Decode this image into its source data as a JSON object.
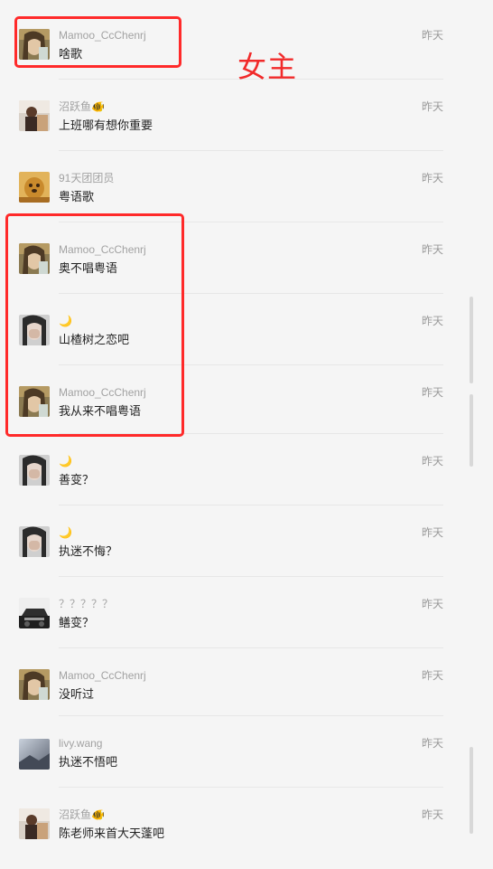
{
  "annotation": {
    "label": "女主",
    "color": "#f12a2a"
  },
  "messages": [
    {
      "name": "Mamoo_CcChenrj",
      "text": "啥歌",
      "time": "昨天",
      "avatar": "girl-avatar-icon"
    },
    {
      "name": "沼跃鱼🐠",
      "text": "上班哪有想你重要",
      "time": "昨天",
      "avatar": "man-avatar-icon"
    },
    {
      "name": "91天团团员",
      "text": "粤语歌",
      "time": "昨天",
      "avatar": "dog-avatar-icon"
    },
    {
      "name": "Mamoo_CcChenrj",
      "text": "奥不唱粤语",
      "time": "昨天",
      "avatar": "girl-avatar-icon"
    },
    {
      "name": "🌙",
      "text": "山楂树之恋吧",
      "time": "昨天",
      "avatar": "hand-face-avatar-icon"
    },
    {
      "name": "Mamoo_CcChenrj",
      "text": "我从来不唱粤语",
      "time": "昨天",
      "avatar": "girl-avatar-icon"
    },
    {
      "name": "🌙",
      "text": "善变？",
      "time": "昨天",
      "avatar": "hand-face-avatar-icon"
    },
    {
      "name": "🌙",
      "text": "执迷不悔？",
      "time": "昨天",
      "avatar": "hand-face-avatar-icon"
    },
    {
      "name": "？？？？？",
      "text": "鳝变？",
      "time": "昨天",
      "avatar": "car-avatar-icon"
    },
    {
      "name": "Mamoo_CcChenrj",
      "text": "没听过",
      "time": "昨天",
      "avatar": "girl-avatar-icon"
    },
    {
      "name": "livy.wang",
      "text": "执迷不悟吧",
      "time": "昨天",
      "avatar": "landscape-avatar-icon"
    },
    {
      "name": "沼跃鱼🐠",
      "text": "陈老师来首大天蓬吧",
      "time": "昨天",
      "avatar": "man-avatar-icon"
    }
  ]
}
